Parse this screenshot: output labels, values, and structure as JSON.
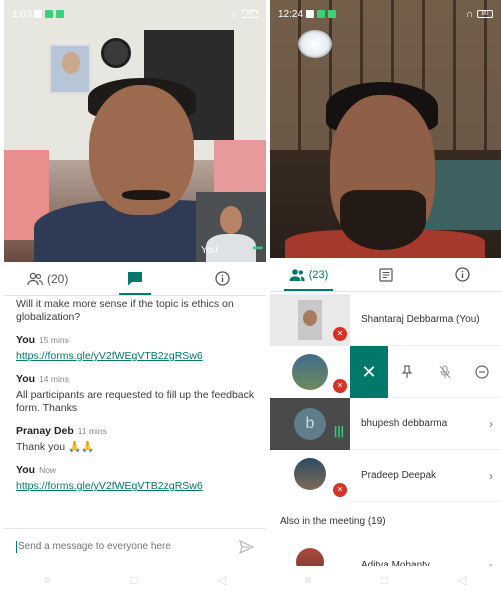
{
  "left": {
    "status": {
      "time": "1:03",
      "battery": "80"
    },
    "self_label": "You",
    "tabs": {
      "people_count": "(20)"
    },
    "chat": [
      {
        "sender": "",
        "time": "",
        "text": "Will it make more sense if the topic is ethics on globalization?",
        "link": ""
      },
      {
        "sender": "You",
        "time": "15 mins",
        "text": "",
        "link": "https://forms.gle/yV2fWEgVTB2zgRSw6"
      },
      {
        "sender": "You",
        "time": "14 mins",
        "text": "All participants are requested to fill up the feedback form. Thanks",
        "link": ""
      },
      {
        "sender": "Pranay Deb",
        "time": "11 mins",
        "text": "Thank you",
        "emoji": "🙏🙏",
        "link": ""
      },
      {
        "sender": "You",
        "time": "Now",
        "text": "",
        "link": "https://forms.gle/yV2fWEgVTB2zgRSw6"
      }
    ],
    "compose_placeholder": "Send a message to everyone here"
  },
  "right": {
    "status": {
      "time": "12:24",
      "battery": "80"
    },
    "tabs": {
      "people_count": "(23)"
    },
    "participants": [
      {
        "name": "Shantaraj Debbarma (You)",
        "mic": "off"
      },
      {
        "name": "",
        "mic": "off",
        "actions_open": true
      },
      {
        "name": "bhupesh debbarma",
        "mic": "speaking",
        "initial": "b"
      },
      {
        "name": "Pradeep Deepak",
        "mic": "off"
      }
    ],
    "section_label": "Also in the meeting (19)",
    "next_participant": "Aditya Mohanty"
  },
  "colors": {
    "accent": "#00796b",
    "mic_off": "#d93025",
    "speaking": "#34c77b"
  },
  "icons": [
    "people-icon",
    "chat-icon",
    "info-icon",
    "close-icon",
    "pin-icon",
    "mic-off-icon",
    "remove-icon",
    "send-icon",
    "chevron-right-icon"
  ]
}
